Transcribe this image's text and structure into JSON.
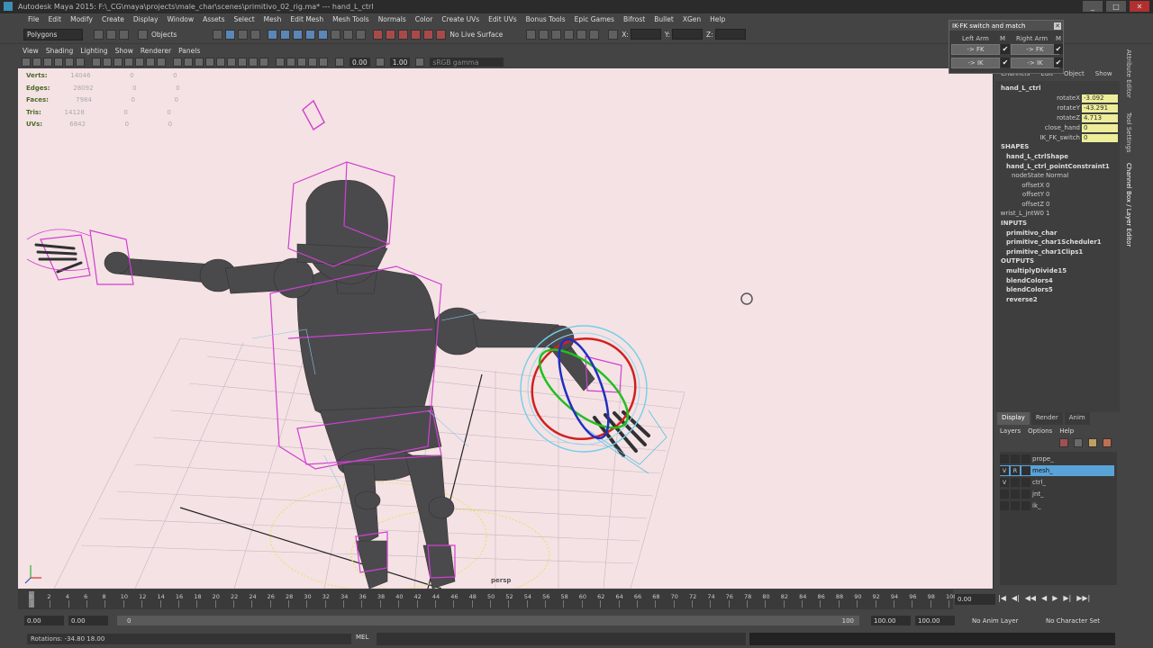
{
  "window": {
    "title": "Autodesk Maya 2015: F:\\_CG\\maya\\projects\\male_char\\scenes\\primitivo_02_rig.ma*   ---   hand_L_ctrl",
    "min": "_",
    "max": "□",
    "close": "✕"
  },
  "menubar": [
    "File",
    "Edit",
    "Modify",
    "Create",
    "Display",
    "Window",
    "Assets",
    "Select",
    "Mesh",
    "Edit Mesh",
    "Mesh Tools",
    "Normals",
    "Color",
    "Create UVs",
    "Edit UVs",
    "Bonus Tools",
    "Epic Games",
    "Bifrost",
    "Bullet",
    "XGen",
    "Help"
  ],
  "statusline": {
    "mode": "Polygons",
    "objects_label": "Objects",
    "live_surface": "No Live Surface",
    "x_label": "X:",
    "y_label": "Y:",
    "z_label": "Z:"
  },
  "panel_menu": [
    "View",
    "Shading",
    "Lighting",
    "Show",
    "Renderer",
    "Panels"
  ],
  "panel_toolbar": {
    "near_value": "0.00",
    "far_value": "1.00",
    "colorspace": "sRGB gamma"
  },
  "hud": {
    "rows": [
      {
        "label": "Verts:",
        "v1": "14046",
        "v2": "0",
        "v3": "0"
      },
      {
        "label": "Edges:",
        "v1": "28092",
        "v2": "0",
        "v3": "0"
      },
      {
        "label": "Faces:",
        "v1": "7984",
        "v2": "0",
        "v3": "0"
      },
      {
        "label": "Tris:",
        "v1": "14128",
        "v2": "0",
        "v3": "0"
      },
      {
        "label": "UVs:",
        "v1": "6842",
        "v2": "0",
        "v3": "0"
      }
    ]
  },
  "viewport": {
    "camera_label": "persp"
  },
  "ikfk": {
    "title": "IK-FK switch and match",
    "left_arm": "Left Arm",
    "right_arm": "Right Arm",
    "m": "M",
    "fk_btn": "-> FK",
    "ik_btn": "-> IK",
    "check": "✔"
  },
  "channel_box": {
    "header": [
      "Channels",
      "Edit",
      "Object",
      "Show"
    ],
    "object": "hand_L_ctrl",
    "attrs": [
      {
        "name": "rotateX",
        "value": "-3.092"
      },
      {
        "name": "rotateY",
        "value": "-43.291"
      },
      {
        "name": "rotateZ",
        "value": "4.713"
      },
      {
        "name": "close_hand",
        "value": "0"
      },
      {
        "name": "IK_FK_switch",
        "value": "0"
      }
    ],
    "shapes_label": "SHAPES",
    "shapes": [
      "hand_L_ctrlShape",
      "hand_L_ctrl_pointConstraint1"
    ],
    "constraint_attrs": [
      {
        "name": "nodeState",
        "value": "Normal"
      },
      {
        "name": "offsetX",
        "value": "0"
      },
      {
        "name": "offsetY",
        "value": "0"
      },
      {
        "name": "offsetZ",
        "value": "0"
      },
      {
        "name": "wrist_L_jntW0",
        "value": "1"
      }
    ],
    "inputs_label": "INPUTS",
    "inputs": [
      "primitivo_char",
      "primitive_char1Scheduler1",
      "primitive_char1Clips1"
    ],
    "outputs_label": "OUTPUTS",
    "outputs": [
      "multiplyDivide15",
      "blendColors4",
      "blendColors5",
      "reverse2"
    ]
  },
  "side_tabs": [
    "Attribute Editor",
    "Tool Settings",
    "Channel Box / Layer Editor"
  ],
  "layer_editor": {
    "tabs": [
      "Display",
      "Render",
      "Anim"
    ],
    "menu": [
      "Layers",
      "Options",
      "Help"
    ],
    "layers": [
      {
        "v": "",
        "r": "",
        "name": "prope_"
      },
      {
        "v": "V",
        "r": "R",
        "name": "mesh_"
      },
      {
        "v": "V",
        "r": "",
        "name": "ctrl_"
      },
      {
        "v": "",
        "r": "",
        "name": "jnt_"
      },
      {
        "v": "",
        "r": "",
        "name": "ik_"
      }
    ]
  },
  "timeline": {
    "ticks": [
      "0",
      "2",
      "4",
      "6",
      "8",
      "10",
      "12",
      "14",
      "16",
      "18",
      "20",
      "22",
      "24",
      "26",
      "28",
      "30",
      "32",
      "34",
      "36",
      "38",
      "40",
      "42",
      "44",
      "46",
      "48",
      "50",
      "52",
      "54",
      "56",
      "58",
      "60",
      "62",
      "64",
      "66",
      "68",
      "70",
      "72",
      "74",
      "76",
      "78",
      "80",
      "82",
      "84",
      "86",
      "88",
      "90",
      "92",
      "94",
      "96",
      "98",
      "100"
    ],
    "current_frame": "0.00"
  },
  "playback": [
    "|◀",
    "◀|",
    "◀◀",
    "◀",
    "▶",
    "▶|",
    "▶▶|"
  ],
  "range": {
    "start": "0.00",
    "anim_start": "0.00",
    "slider_start": "0",
    "slider_end": "100",
    "anim_end": "100.00",
    "end": "100.00",
    "anim_layer": "No Anim Layer",
    "character_set": "No Character Set"
  },
  "cmdline": {
    "help": "Rotations: -34.80    18.00",
    "mel": "MEL"
  }
}
